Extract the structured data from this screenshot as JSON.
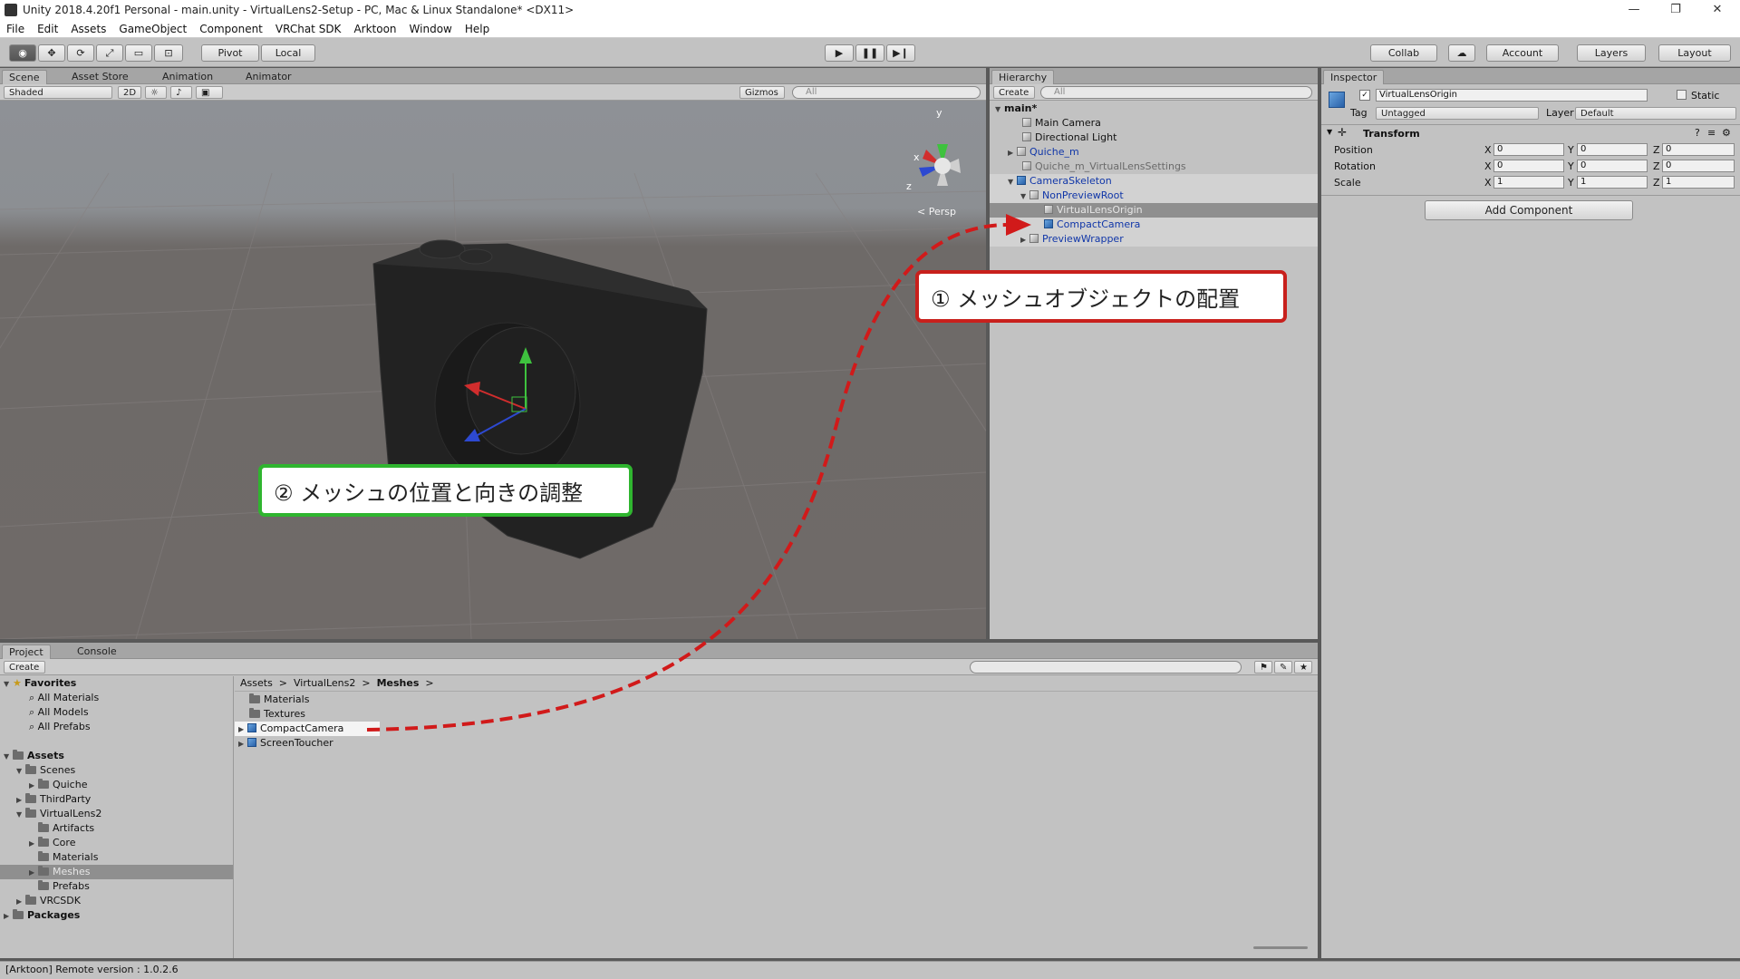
{
  "title": "Unity 2018.4.20f1 Personal - main.unity - VirtualLens2-Setup - PC, Mac & Linux Standalone* <DX11>",
  "menu": [
    "File",
    "Edit",
    "Assets",
    "GameObject",
    "Component",
    "VRChat SDK",
    "Arktoon",
    "Window",
    "Help"
  ],
  "toolbar": {
    "pivot": "Pivot",
    "local": "Local",
    "collab": "Collab",
    "account": "Account",
    "layers": "Layers",
    "layout": "Layout"
  },
  "scene": {
    "tabs": [
      "Scene",
      "Asset Store",
      "Animation",
      "Animator"
    ],
    "shading": "Shaded",
    "mode2d": "2D",
    "gizmos": "Gizmos",
    "search_placeholder": "All",
    "persp": "Persp",
    "axis_y": "y",
    "axis_x": "x",
    "axis_z": "z"
  },
  "hierarchy": {
    "tab": "Hierarchy",
    "create": "Create",
    "search_placeholder": "All",
    "scene": "main*",
    "items": [
      "Main Camera",
      "Directional Light",
      "Quiche_m",
      "Quiche_m_VirtualLensSettings",
      "CameraSkeleton",
      "NonPreviewRoot",
      "VirtualLensOrigin",
      "CompactCamera",
      "PreviewWrapper"
    ]
  },
  "inspector": {
    "tab": "Inspector",
    "object_name": "VirtualLensOrigin",
    "static": "Static",
    "tag_label": "Tag",
    "tag_value": "Untagged",
    "layer_label": "Layer",
    "layer_value": "Default",
    "component": "Transform",
    "rows": [
      {
        "label": "Position",
        "x": "0",
        "y": "0",
        "z": "0"
      },
      {
        "label": "Rotation",
        "x": "0",
        "y": "0",
        "z": "0"
      },
      {
        "label": "Scale",
        "x": "1",
        "y": "1",
        "z": "1"
      }
    ],
    "add_component": "Add Component"
  },
  "project": {
    "tabs": [
      "Project",
      "Console"
    ],
    "create": "Create",
    "favorites": {
      "title": "Favorites",
      "items": [
        "All Materials",
        "All Models",
        "All Prefabs"
      ]
    },
    "assets_title": "Assets",
    "tree": [
      "Scenes",
      "Quiche",
      "ThirdParty",
      "VirtualLens2",
      "Artifacts",
      "Core",
      "Materials",
      "Meshes",
      "Prefabs",
      "VRCSDK"
    ],
    "packages": "Packages",
    "breadcrumb": [
      "Assets",
      "VirtualLens2",
      "Meshes"
    ],
    "files": [
      "Materials",
      "Textures",
      "CompactCamera",
      "ScreenToucher"
    ]
  },
  "status": "[Arktoon] Remote version : 1.0.2.6",
  "callouts": {
    "one": "① メッシュオブジェクトの配置",
    "two": "② メッシュの位置と向きの調整"
  },
  "colors": {
    "red_callout": "#c8201c",
    "green_callout": "#2fb52f",
    "dash": "#d11a1a"
  }
}
